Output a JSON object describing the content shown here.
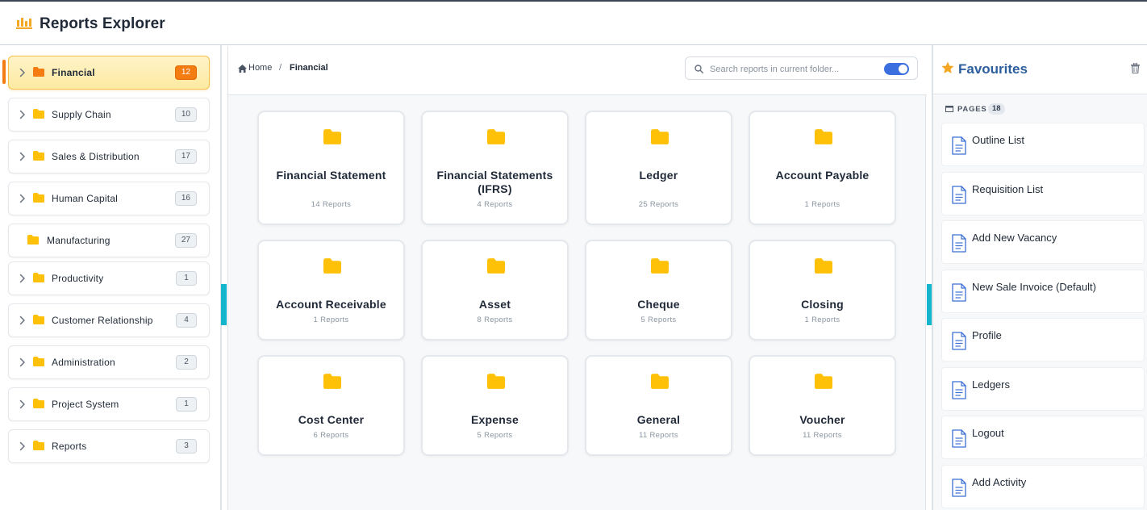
{
  "app": {
    "title": "Reports Explorer",
    "logo_icon": "bar-chart-icon",
    "accent_color": "#f47c11"
  },
  "sidebar": {
    "items": [
      {
        "label": "Financial",
        "count": "12",
        "active": true,
        "expandable": true
      },
      {
        "label": "Supply Chain",
        "count": "10",
        "expandable": true
      },
      {
        "label": "Sales & Distribution",
        "count": "17",
        "expandable": true
      },
      {
        "label": "Human Capital",
        "count": "16",
        "expandable": true
      },
      {
        "label": "Manufacturing",
        "count": "27",
        "expandable": false
      },
      {
        "label": "Productivity",
        "count": "1",
        "expandable": true
      },
      {
        "label": "Customer Relationship",
        "count": "4",
        "expandable": true
      },
      {
        "label": "Administration",
        "count": "2",
        "expandable": true
      },
      {
        "label": "Project System",
        "count": "1",
        "expandable": true
      },
      {
        "label": "Reports",
        "count": "3",
        "expandable": true
      }
    ]
  },
  "breadcrumb": {
    "home": "Home",
    "separator": "/",
    "current": "Financial"
  },
  "search": {
    "placeholder": "Search reports in current folder...",
    "value": "",
    "toggle_on": true
  },
  "cards": [
    {
      "title": "Financial Statement",
      "count": "14 Reports"
    },
    {
      "title": "Financial Statements (IFRS)",
      "count": "4 Reports"
    },
    {
      "title": "Ledger",
      "count": "25 Reports"
    },
    {
      "title": "Account Payable",
      "count": "1 Reports"
    },
    {
      "title": "Account Receivable",
      "count": "1 Reports"
    },
    {
      "title": "Asset",
      "count": "8 Reports"
    },
    {
      "title": "Cheque",
      "count": "5 Reports"
    },
    {
      "title": "Closing",
      "count": "1 Reports"
    },
    {
      "title": "Cost Center",
      "count": "6 Reports"
    },
    {
      "title": "Expense",
      "count": "5 Reports"
    },
    {
      "title": "General",
      "count": "11 Reports"
    },
    {
      "title": "Voucher",
      "count": "11 Reports"
    }
  ],
  "favourites": {
    "title": "Favourites",
    "section_label": "PAGES",
    "section_count": "18",
    "items": [
      "Outline List",
      "Requisition List",
      "Add New Vacancy",
      "New Sale Invoice (Default)",
      "Profile",
      "Ledgers",
      "Logout",
      "Add Activity"
    ]
  },
  "colors": {
    "folder": "#ffc107",
    "folder_active": "#f47c11",
    "doc_icon": "#3b6fd4",
    "handle": "#12b5cb",
    "fav_title": "#2d5f9e",
    "toggle": "#3b6fe0"
  }
}
